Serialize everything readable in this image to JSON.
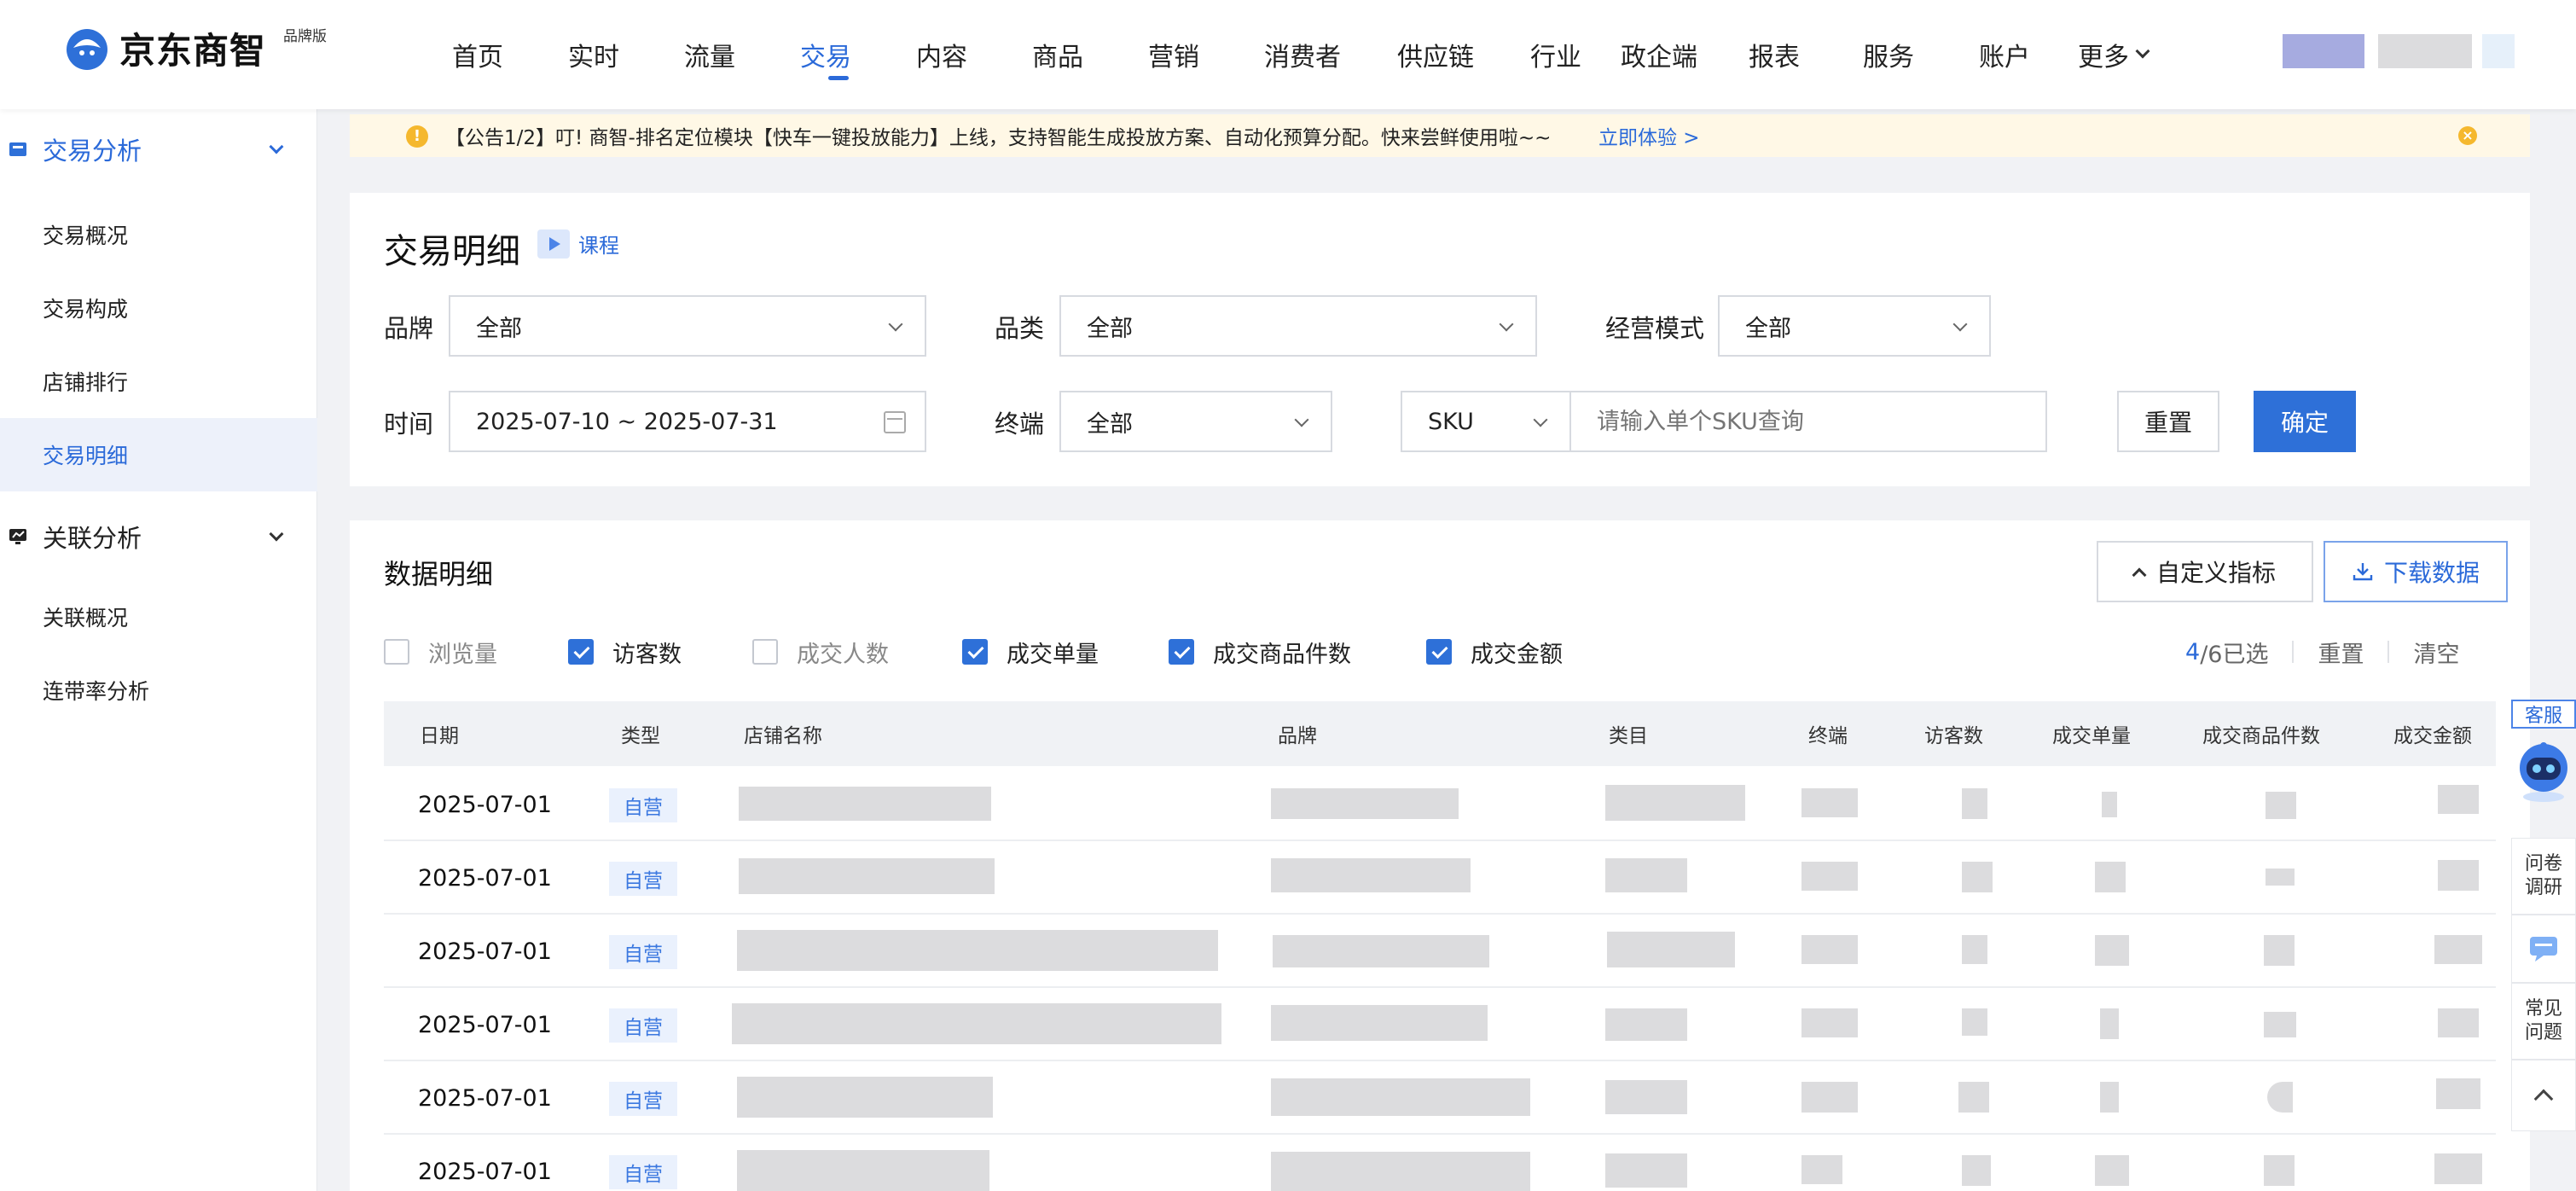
{
  "header": {
    "logo_text": "京东商智",
    "logo_badge": "品牌版",
    "nav": [
      "首页",
      "实时",
      "流量",
      "交易",
      "内容",
      "商品",
      "营销",
      "消费者",
      "供应链",
      "行业",
      "政企端",
      "报表",
      "服务",
      "账户",
      "更多"
    ],
    "active_nav": "交易"
  },
  "sidebar": {
    "groups": [
      {
        "label": "交易分析",
        "items": [
          "交易概况",
          "交易构成",
          "店铺排行",
          "交易明细"
        ]
      },
      {
        "label": "关联分析",
        "items": [
          "关联概况",
          "连带率分析"
        ]
      }
    ],
    "active_item": "交易明细"
  },
  "notice": {
    "icon": "info-icon",
    "text": "【公告1/2】叮! 商智-排名定位模块【快车一键投放能力】上线，支持智能生成投放方案、自动化预算分配。快来尝鲜使用啦~~",
    "link": "立即体验 >"
  },
  "filters": {
    "title": "交易明细",
    "course_label": "课程",
    "brand": {
      "label": "品牌",
      "value": "全部"
    },
    "category": {
      "label": "品类",
      "value": "全部"
    },
    "mode": {
      "label": "经营模式",
      "value": "全部"
    },
    "time": {
      "label": "时间",
      "value": "2025-07-10 ~ 2025-07-31"
    },
    "terminal": {
      "label": "终端",
      "value": "全部"
    },
    "sku": {
      "value": "SKU",
      "placeholder": "请输入单个SKU查询"
    },
    "reset_label": "重置",
    "confirm_label": "确定"
  },
  "data_section": {
    "title": "数据明细",
    "custom_metrics_label": "自定义指标",
    "download_label": "下载数据",
    "metrics": [
      {
        "label": "浏览量",
        "checked": false
      },
      {
        "label": "访客数",
        "checked": true
      },
      {
        "label": "成交人数",
        "checked": false
      },
      {
        "label": "成交单量",
        "checked": true
      },
      {
        "label": "成交商品件数",
        "checked": true
      },
      {
        "label": "成交金额",
        "checked": true
      }
    ],
    "selected_count": "4",
    "selected_total": "/6已选",
    "reset_label": "重置",
    "clear_label": "清空",
    "columns": [
      "日期",
      "类型",
      "店铺名称",
      "品牌",
      "类目",
      "终端",
      "访客数",
      "成交单量",
      "成交商品件数",
      "成交金额"
    ],
    "rows": [
      {
        "date": "2025-07-01",
        "type": "自营"
      },
      {
        "date": "2025-07-01",
        "type": "自营"
      },
      {
        "date": "2025-07-01",
        "type": "自营"
      },
      {
        "date": "2025-07-01",
        "type": "自营"
      },
      {
        "date": "2025-07-01",
        "type": "自营"
      },
      {
        "date": "2025-07-01",
        "type": "自营"
      }
    ]
  },
  "float_panel": {
    "service_label": "客服",
    "survey_label": "问卷调研",
    "faq_label": "常见问题"
  },
  "colors": {
    "primary": "#2e70d8",
    "notice_bg": "#fff8e6",
    "tag_bg": "#eaf1fd"
  }
}
